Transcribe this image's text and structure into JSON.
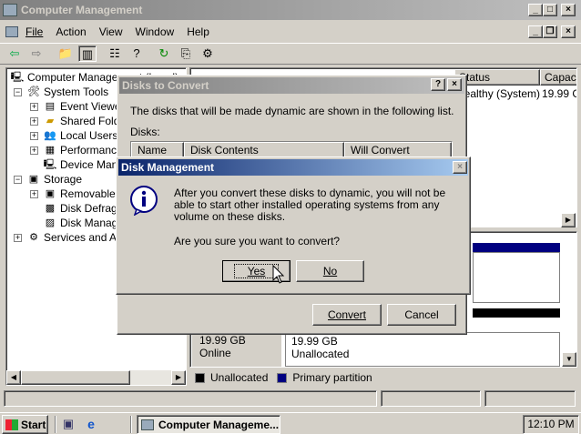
{
  "window": {
    "title": "Computer Management"
  },
  "menu": [
    "File",
    "Action",
    "View",
    "Window",
    "Help"
  ],
  "toolbar_icons": [
    "back-icon",
    "forward-icon",
    "up-folder-icon",
    "show-hide-tree-icon",
    "properties-icon",
    "help-icon",
    "refresh-icon",
    "export-icon",
    "settings-icon"
  ],
  "tree": {
    "root": "Computer Management (Local)",
    "system_tools": "System Tools",
    "event_viewer": "Event Viewer",
    "shared_folders": "Shared Folders",
    "local_users": "Local Users and Groups",
    "performance": "Performance Logs and Alerts",
    "device_manager": "Device Manager",
    "storage": "Storage",
    "removable": "Removable Storage",
    "defrag": "Disk Defragmenter",
    "disk_mgmt": "Disk Management",
    "services": "Services and Applications"
  },
  "volume_list": {
    "status_header": "Status",
    "capacity_header": "Capacity",
    "status_value": "Healthy (System)",
    "capacity_value": "19.99 GB"
  },
  "disk_panel": {
    "size": "19.99 GB",
    "state": "Online",
    "unalloc_size": "19.99 GB",
    "unalloc_label": "Unallocated"
  },
  "legend": {
    "unallocated": "Unallocated",
    "primary": "Primary partition",
    "unallocated_color": "#000000",
    "primary_color": "#000080"
  },
  "convert_dialog": {
    "title": "Disks to Convert",
    "description": "The disks that will be made dynamic are shown in the following list.",
    "disks_label": "Disks:",
    "columns": [
      "Name",
      "Disk Contents",
      "Will Convert"
    ],
    "convert_button": "Convert",
    "cancel_button": "Cancel"
  },
  "confirm_dialog": {
    "title": "Disk Management",
    "message": "After you convert these disks to dynamic, you will not be able to start other installed operating systems from any volume on these disks.",
    "question": "Are you sure you want to convert?",
    "yes_button": "Yes",
    "no_button": "No"
  },
  "taskbar": {
    "start": "Start",
    "task": "Computer Manageme...",
    "clock": "12:10 PM"
  }
}
